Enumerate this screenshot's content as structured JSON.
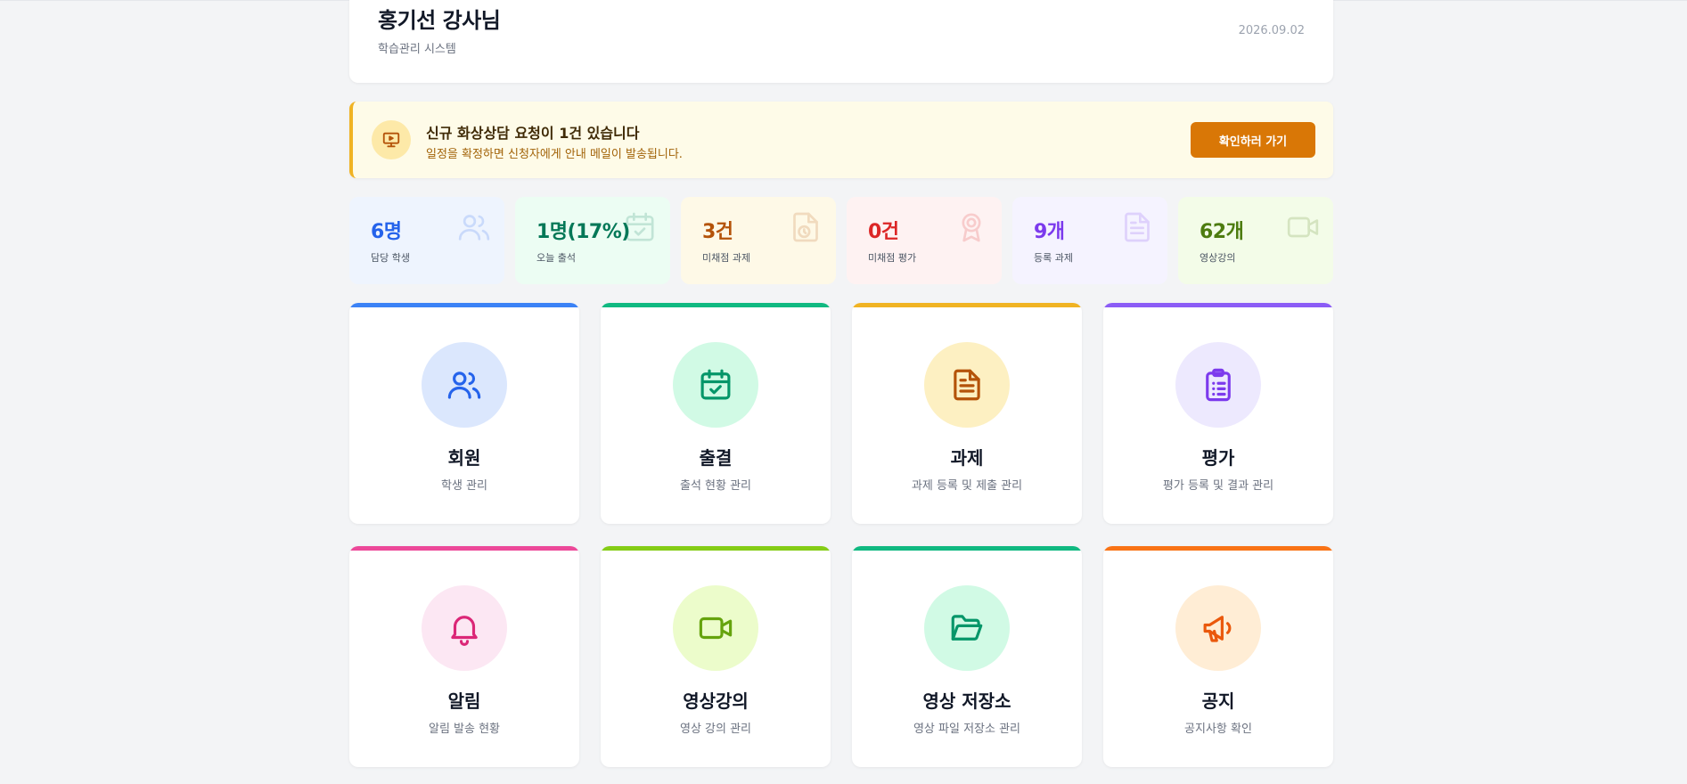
{
  "header": {
    "title": "홍기선 강사님",
    "subtitle": "학습관리 시스템",
    "date": "2026.09.02"
  },
  "alert": {
    "icon": "video-presentation-icon",
    "title": "신규 화상상담 요청이 1건 있습니다",
    "description": "일정을 확정하면 신청자에게 안내 메일이 발송됩니다.",
    "button_label": "확인하러 가기"
  },
  "stats": [
    {
      "value": "6명",
      "label": "담당 학생",
      "icon": "users-icon",
      "color": "#2563eb",
      "bg": "#eef4fe"
    },
    {
      "value": "1명(17%)",
      "label": "오늘 출석",
      "icon": "calendar-check-icon",
      "color": "#047857",
      "bg": "#ecfdf3"
    },
    {
      "value": "3건",
      "label": "미채점 과제",
      "icon": "document-clock-icon",
      "color": "#b45309",
      "bg": "#fef9e7"
    },
    {
      "value": "0건",
      "label": "미채점 평가",
      "icon": "award-icon",
      "color": "#dc2626",
      "bg": "#fef2f2"
    },
    {
      "value": "9개",
      "label": "등록 과제",
      "icon": "document-icon",
      "color": "#7c3aed",
      "bg": "#f5f3ff"
    },
    {
      "value": "62개",
      "label": "영상강의",
      "icon": "video-camera-icon",
      "color": "#4d7c0f",
      "bg": "#f3fce8"
    }
  ],
  "cards": [
    {
      "title": "회원",
      "desc": "학생 관리",
      "icon": "users-icon",
      "bar": "#3b82f6",
      "circle": "#dbe7fd",
      "stroke": "#2563eb"
    },
    {
      "title": "출결",
      "desc": "출석 현황 관리",
      "icon": "calendar-check-icon",
      "bar": "#10b981",
      "circle": "#d1fae5",
      "stroke": "#059669"
    },
    {
      "title": "과제",
      "desc": "과제 등록 및 제출 관리",
      "icon": "document-icon",
      "bar": "#f0b323",
      "circle": "#fdf0c2",
      "stroke": "#b45309"
    },
    {
      "title": "평가",
      "desc": "평가 등록 및 결과 관리",
      "icon": "clipboard-list-icon",
      "bar": "#8b5cf6",
      "circle": "#ede9fe",
      "stroke": "#7c3aed"
    },
    {
      "title": "알림",
      "desc": "알림 발송 현황",
      "icon": "bell-icon",
      "bar": "#ec4899",
      "circle": "#fce7f3",
      "stroke": "#db2777"
    },
    {
      "title": "영상강의",
      "desc": "영상 강의 관리",
      "icon": "video-camera-icon",
      "bar": "#84cc16",
      "circle": "#ecfccb",
      "stroke": "#65a30d"
    },
    {
      "title": "영상 저장소",
      "desc": "영상 파일 저장소 관리",
      "icon": "folder-open-icon",
      "bar": "#10b981",
      "circle": "#d1fae5",
      "stroke": "#059669"
    },
    {
      "title": "공지",
      "desc": "공지사항 확인",
      "icon": "megaphone-icon",
      "bar": "#f97316",
      "circle": "#ffedd5",
      "stroke": "#ea580c"
    }
  ]
}
